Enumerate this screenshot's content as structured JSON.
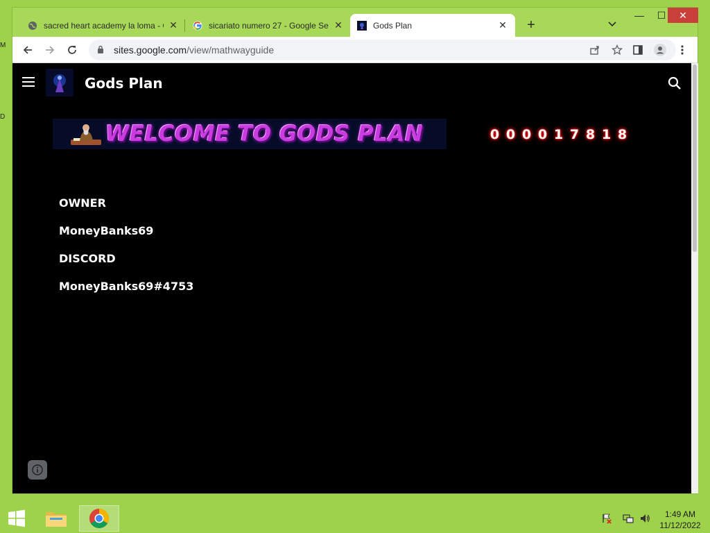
{
  "desktop": {
    "edge_letters": [
      "M",
      "D"
    ]
  },
  "browser": {
    "tabs": [
      {
        "title": "sacred heart academy la loma - G",
        "active": false,
        "favicon": "globe-icon"
      },
      {
        "title": "sicariato numero 27 - Google Se",
        "active": false,
        "favicon": "google-g-icon"
      },
      {
        "title": "Gods Plan",
        "active": true,
        "favicon": "site-favicon"
      }
    ],
    "new_tab_label": "+",
    "close_glyph": "✕",
    "window_controls": {
      "minimize": "—",
      "maximize": "☐",
      "close": "✕"
    },
    "address_bar": {
      "host": "sites.google.com",
      "path": "/view/mathwayguide"
    }
  },
  "site": {
    "title": "Gods Plan",
    "banner_text": "WELCOME TO GODS PLAN",
    "visitor_counter": [
      "0",
      "0",
      "0",
      "0",
      "1",
      "7",
      "8",
      "1",
      "8"
    ],
    "content": {
      "owner_heading": "OWNER",
      "owner_name": "MoneyBanks69",
      "discord_heading": "DISCORD",
      "discord_handle": "MoneyBanks69#4753"
    }
  },
  "taskbar": {
    "clock_time": "1:49 AM",
    "clock_date": "11/12/2022"
  },
  "colors": {
    "desktop_green": "#9ed24a",
    "banner_magenta": "#c93de0",
    "counter_red": "#e00000",
    "page_bg": "#000000"
  }
}
